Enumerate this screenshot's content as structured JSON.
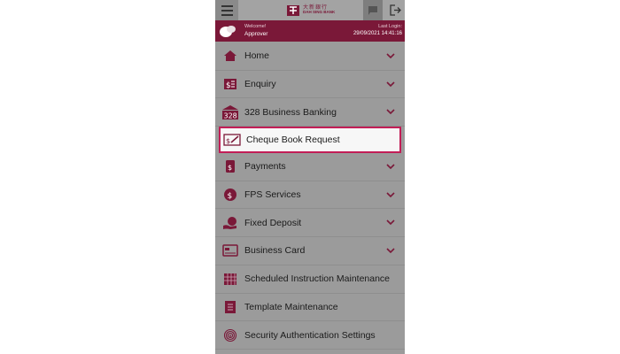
{
  "header": {
    "bank_name_cn": "大新銀行",
    "bank_name_en": "DAH SING BANK"
  },
  "user": {
    "welcome_label": "Welcome!",
    "role": "Approver",
    "last_login_label": "Last Login:",
    "last_login_time": "29/09/2021 14:41:16"
  },
  "menu": [
    {
      "label": "Home",
      "icon": "home-icon",
      "expandable": true
    },
    {
      "label": "Enquiry",
      "icon": "enquiry-icon",
      "expandable": true
    },
    {
      "label": "328 Business Banking",
      "icon": "business-banking-icon",
      "expandable": true
    },
    {
      "label": "Cheque Book Request",
      "icon": "cheque-icon",
      "expandable": false,
      "selected": true
    },
    {
      "label": "Payments",
      "icon": "payments-icon",
      "expandable": true
    },
    {
      "label": "FPS Services",
      "icon": "fps-icon",
      "expandable": true
    },
    {
      "label": "Fixed Deposit",
      "icon": "fixed-deposit-icon",
      "expandable": true
    },
    {
      "label": "Business Card",
      "icon": "card-icon",
      "expandable": true
    },
    {
      "label": "Scheduled Instruction Maintenance",
      "icon": "calendar-icon",
      "expandable": false
    },
    {
      "label": "Template Maintenance",
      "icon": "template-icon",
      "expandable": false
    },
    {
      "label": "Security Authentication Settings",
      "icon": "fingerprint-icon",
      "expandable": false
    }
  ],
  "colors": {
    "brand": "#7a1838",
    "highlight": "#c21e57",
    "overlay": "#9b9b9b"
  }
}
